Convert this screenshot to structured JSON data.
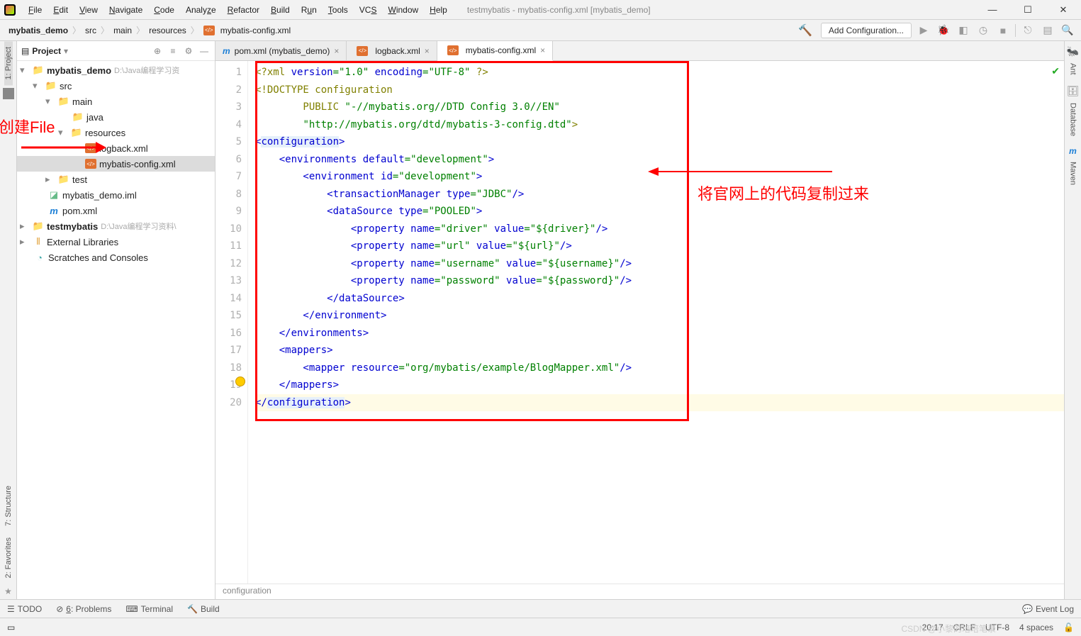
{
  "window_title": "testmybatis - mybatis-config.xml [mybatis_demo]",
  "menu": [
    "File",
    "Edit",
    "View",
    "Navigate",
    "Code",
    "Analyze",
    "Refactor",
    "Build",
    "Run",
    "Tools",
    "VCS",
    "Window",
    "Help"
  ],
  "breadcrumbs": [
    "mybatis_demo",
    "src",
    "main",
    "resources",
    "mybatis-config.xml"
  ],
  "add_config": "Add Configuration...",
  "project_label": "Project",
  "tree": {
    "root": "mybatis_demo",
    "root_path": "D:\\Java编程学习资",
    "src": "src",
    "main": "main",
    "java": "java",
    "resources": "resources",
    "logback": "logback.xml",
    "mybatis_cfg": "mybatis-config.xml",
    "test": "test",
    "iml": "mybatis_demo.iml",
    "pom": "pom.xml",
    "testmybatis": "testmybatis",
    "testmybatis_path": "D:\\Java编程学习资料\\",
    "extlib": "External Libraries",
    "scratch": "Scratches and Consoles"
  },
  "tabs": [
    {
      "label": "pom.xml (mybatis_demo)",
      "type": "mvn"
    },
    {
      "label": "logback.xml",
      "type": "xml"
    },
    {
      "label": "mybatis-config.xml",
      "type": "xml",
      "active": true
    }
  ],
  "gutter_lines": [
    "1",
    "2",
    "3",
    "4",
    "5",
    "6",
    "7",
    "8",
    "9",
    "10",
    "11",
    "12",
    "13",
    "14",
    "15",
    "16",
    "17",
    "18",
    "19",
    "20"
  ],
  "code": {
    "l1_a": "<?xml ",
    "l1_b": "version",
    "l1_c": "=\"1.0\" ",
    "l1_d": "encoding",
    "l1_e": "=\"UTF-8\" ",
    "l1_f": "?>",
    "l2": "<!DOCTYPE configuration",
    "l3_a": "        PUBLIC ",
    "l3_b": "\"-//mybatis.org//DTD Config 3.0//EN\"",
    "l4_a": "        ",
    "l4_b": "\"http://mybatis.org/dtd/mybatis-3-config.dtd\"",
    "l4_c": ">",
    "l5_a": "<",
    "l5_b": "configuration",
    "l5_c": ">",
    "l6_a": "    <",
    "l6_b": "environments ",
    "l6_c": "default",
    "l6_d": "=\"development\"",
    "l6_e": ">",
    "l7_a": "        <",
    "l7_b": "environment ",
    "l7_c": "id",
    "l7_d": "=\"development\"",
    "l7_e": ">",
    "l8_a": "            <",
    "l8_b": "transactionManager ",
    "l8_c": "type",
    "l8_d": "=\"JDBC\"",
    "l8_e": "/>",
    "l9_a": "            <",
    "l9_b": "dataSource ",
    "l9_c": "type",
    "l9_d": "=\"POOLED\"",
    "l9_e": ">",
    "l10_a": "                <",
    "l10_b": "property ",
    "l10_c": "name",
    "l10_d": "=\"driver\" ",
    "l10_e": "value",
    "l10_f": "=\"${driver}\"",
    "l10_g": "/>",
    "l11_a": "                <",
    "l11_b": "property ",
    "l11_c": "name",
    "l11_d": "=\"url\" ",
    "l11_e": "value",
    "l11_f": "=\"${url}\"",
    "l11_g": "/>",
    "l12_a": "                <",
    "l12_b": "property ",
    "l12_c": "name",
    "l12_d": "=\"username\" ",
    "l12_e": "value",
    "l12_f": "=\"${username}\"",
    "l12_g": "/>",
    "l13_a": "                <",
    "l13_b": "property ",
    "l13_c": "name",
    "l13_d": "=\"password\" ",
    "l13_e": "value",
    "l13_f": "=\"${password}\"",
    "l13_g": "/>",
    "l14_a": "            </",
    "l14_b": "dataSource",
    "l14_c": ">",
    "l15_a": "        </",
    "l15_b": "environment",
    "l15_c": ">",
    "l16_a": "    </",
    "l16_b": "environments",
    "l16_c": ">",
    "l17_a": "    <",
    "l17_b": "mappers",
    "l17_c": ">",
    "l18_a": "        <",
    "l18_b": "mapper ",
    "l18_c": "resource",
    "l18_d": "=\"org/mybatis/example/BlogMapper.xml\"",
    "l18_e": "/>",
    "l19_a": "    </",
    "l19_b": "mappers",
    "l19_c": ">",
    "l20_a": "</",
    "l20_b": "configuration",
    "l20_c": ">"
  },
  "crumb_bottom": "configuration",
  "annotations": {
    "left": "创建File",
    "right": "将官网上的代码复制过来"
  },
  "left_tabs": [
    "1: Project",
    "7: Structure",
    "2: Favorites"
  ],
  "right_tabs": [
    "Ant",
    "Database",
    "Maven"
  ],
  "bottom": {
    "todo": "TODO",
    "problems": "6: Problems",
    "terminal": "Terminal",
    "build": "Build",
    "eventlog": "Event Log"
  },
  "status": {
    "pos": "20:17",
    "sep": "CRLF",
    "enc": "UTF-8",
    "indent": "4 spaces"
  },
  "watermark": "CSDN @小黎的培培笔录"
}
